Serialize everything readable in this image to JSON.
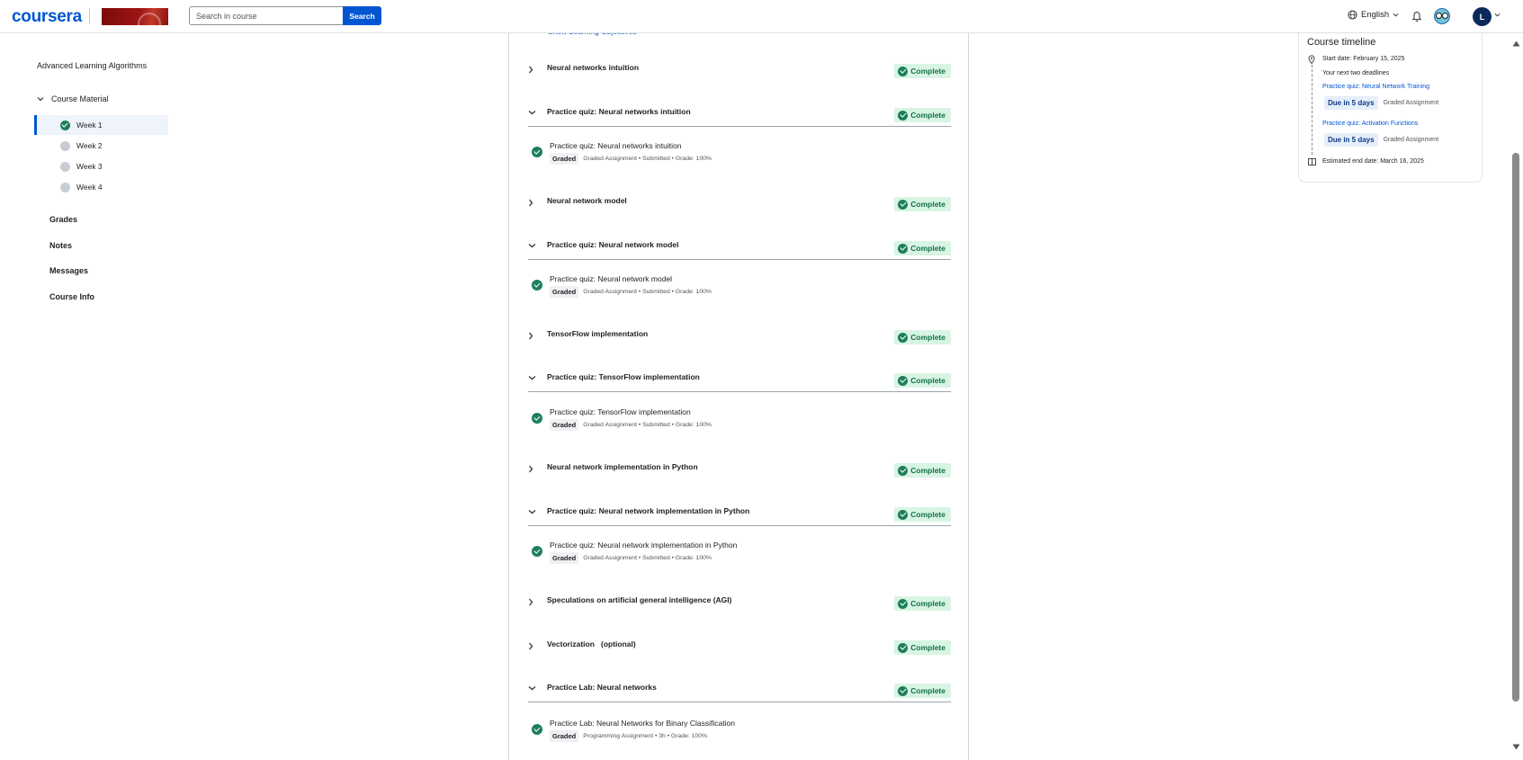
{
  "header": {
    "logo": "coursera",
    "partner_logo": "partner-logo",
    "search_placeholder": "Search in course",
    "search_button": "Search",
    "language": "English",
    "avatar_initial": "L"
  },
  "sidebar": {
    "course_title": "Advanced Learning Algorithms",
    "course_material": "Course Material",
    "weeks": [
      {
        "label": "Week 1",
        "status": "complete",
        "active": true
      },
      {
        "label": "Week 2",
        "status": "incomplete"
      },
      {
        "label": "Week 3",
        "status": "incomplete"
      },
      {
        "label": "Week 4",
        "status": "incomplete"
      }
    ],
    "links": [
      "Grades",
      "Notes",
      "Messages",
      "Course Info"
    ]
  },
  "main": {
    "show_learning_objectives": "Show Learning Objectives",
    "complete_label": "Complete",
    "sections": [
      {
        "title": "Neural networks intuition",
        "expanded": false,
        "status": "Complete"
      },
      {
        "title": "Practice quiz: Neural networks intuition",
        "expanded": true,
        "status": "Complete",
        "item": {
          "name": "Practice quiz: Neural networks intuition",
          "tag": "Graded",
          "meta": "Graded Assignment • Submitted • Grade: 100%"
        }
      },
      {
        "title": "Neural network model",
        "expanded": false,
        "status": "Complete"
      },
      {
        "title": "Practice quiz: Neural network model",
        "expanded": true,
        "status": "Complete",
        "item": {
          "name": "Practice quiz: Neural network model",
          "tag": "Graded",
          "meta": "Graded Assignment • Submitted • Grade: 100%"
        }
      },
      {
        "title": "TensorFlow implementation",
        "expanded": false,
        "status": "Complete"
      },
      {
        "title": "Practice quiz: TensorFlow implementation",
        "expanded": true,
        "status": "Complete",
        "item": {
          "name": "Practice quiz: TensorFlow implementation",
          "tag": "Graded",
          "meta": "Graded Assignment • Submitted • Grade: 100%"
        }
      },
      {
        "title": "Neural network implementation in Python",
        "expanded": false,
        "status": "Complete"
      },
      {
        "title": "Practice quiz: Neural network implementation in Python",
        "expanded": true,
        "status": "Complete",
        "item": {
          "name": "Practice quiz: Neural network implementation in Python",
          "tag": "Graded",
          "meta": "Graded Assignment • Submitted • Grade: 100%"
        }
      },
      {
        "title": "Speculations on artificial general intelligence (AGI)",
        "expanded": false,
        "status": "Complete"
      },
      {
        "title": "Vectorization   (optional)",
        "expanded": false,
        "status": "Complete"
      },
      {
        "title": "Practice Lab: Neural networks",
        "expanded": true,
        "status": "Complete",
        "item": {
          "name": "Practice Lab: Neural Networks for Binary Classification",
          "tag": "Graded",
          "meta": "Programming Assignment • 3h • Grade: 100%"
        }
      }
    ]
  },
  "timeline": {
    "title": "Course timeline",
    "start_date": "Start date: February 15, 2025",
    "next_deadlines": "Your next two deadlines",
    "deadlines": [
      {
        "title": "Practice quiz: Neural Network Training",
        "due": "Due in 5 days",
        "type": "Graded Assignment"
      },
      {
        "title": "Practice quiz: Activation Functions",
        "due": "Due in 5 days",
        "type": "Graded Assignment"
      }
    ],
    "end_date": "Estimated end date: March 16, 2025"
  },
  "colors": {
    "brand": "#0056d2",
    "complete_bg": "#d8f4e4",
    "complete_text": "#137347",
    "check": "#1b7f5a"
  },
  "icons": {
    "globe": "globe-icon",
    "bell": "bell-icon",
    "chevron_right": "chevron-right-icon",
    "chevron_down": "chevron-down-icon",
    "check": "check-circle-icon",
    "location": "location-pin-icon",
    "flag": "flag-icon"
  }
}
